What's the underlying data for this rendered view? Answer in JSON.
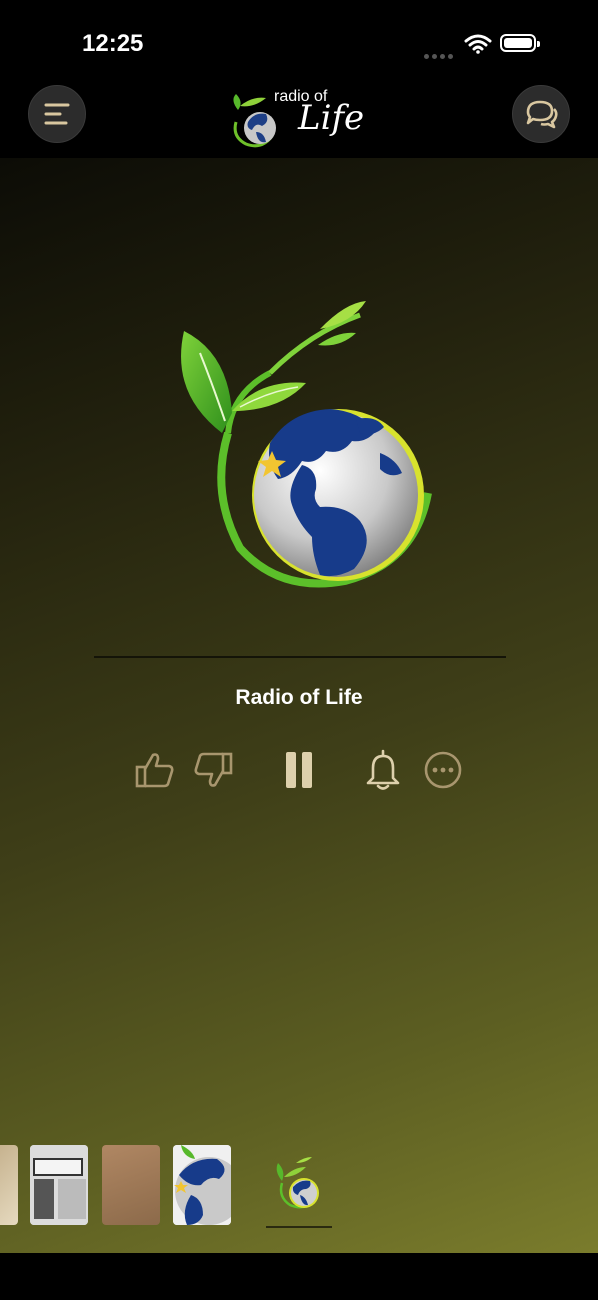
{
  "status": {
    "time": "12:25"
  },
  "header": {
    "logo_line1": "radio of",
    "logo_line2": "Life",
    "menu_icon": "menu-icon",
    "chat_icon": "chat-icon"
  },
  "player": {
    "title": "Radio of Life",
    "state": "playing",
    "controls": [
      "thumbs-up-icon",
      "thumbs-down-icon",
      "pause-icon",
      "bell-icon",
      "more-icon"
    ]
  },
  "colors": {
    "accent": "#d9c7a0",
    "bg_dark": "#0c0c06",
    "bg_light": "#7a7c2c"
  }
}
